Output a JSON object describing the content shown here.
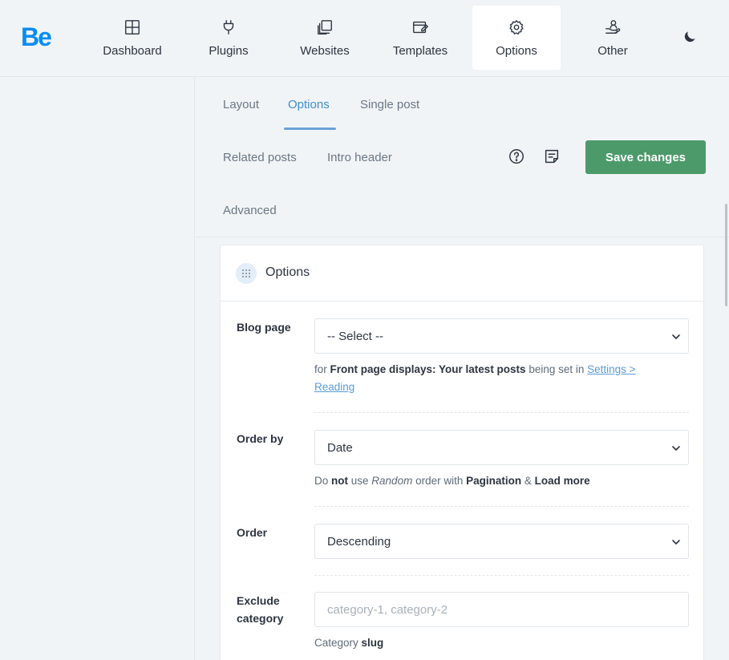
{
  "brand": {
    "logo_text": "Be",
    "color": "#0a8cf2"
  },
  "nav": {
    "items": [
      {
        "label": "Dashboard",
        "icon": "dashboard-icon"
      },
      {
        "label": "Plugins",
        "icon": "plug-icon"
      },
      {
        "label": "Websites",
        "icon": "websites-icon"
      },
      {
        "label": "Templates",
        "icon": "templates-icon"
      },
      {
        "label": "Options",
        "icon": "gear-icon",
        "active": true
      },
      {
        "label": "Other",
        "icon": "hand-user-icon"
      }
    ],
    "theme_toggle_icon": "moon-icon"
  },
  "subtabs": {
    "items": [
      "Layout",
      "Options",
      "Single post",
      "Related posts",
      "Intro header",
      "Advanced"
    ],
    "active": "Options"
  },
  "toolbar": {
    "help_icon": "help-icon",
    "notes_icon": "notes-icon",
    "save_label": "Save changes",
    "save_color": "#4c9a6a"
  },
  "panel": {
    "title": "Options",
    "icon": "drag-dots-icon",
    "blog_page": {
      "label": "Blog page",
      "value": "-- Select --",
      "help_prefix": "for ",
      "help_bold": "Front page displays: Your latest posts",
      "help_mid": " being set in ",
      "help_link": "Settings > Reading"
    },
    "order_by": {
      "label": "Order by",
      "value": "Date",
      "help_1": "Do ",
      "help_not": "not",
      "help_2": " use ",
      "help_random": "Random",
      "help_3": " order with ",
      "help_pagination": "Pagination",
      "help_4": " & ",
      "help_load_more": "Load more"
    },
    "order": {
      "label": "Order",
      "value": "Descending"
    },
    "exclude_category": {
      "label_line1": "Exclude",
      "label_line2": "category",
      "placeholder": "category-1, category-2",
      "help_prefix": "Category ",
      "help_bold": "slug"
    }
  }
}
